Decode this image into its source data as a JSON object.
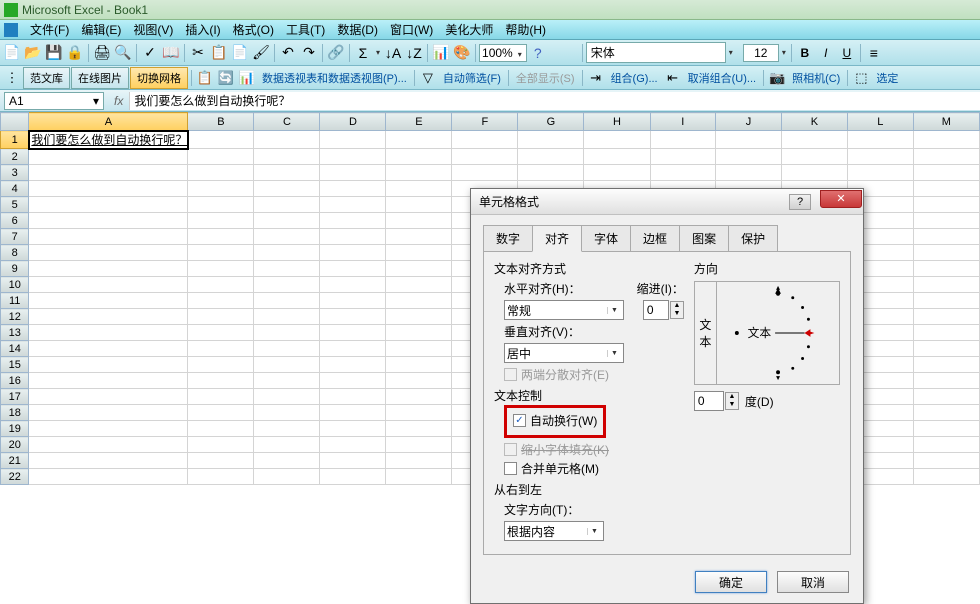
{
  "title": "Microsoft Excel - Book1",
  "menus": [
    "文件(F)",
    "编辑(E)",
    "视图(V)",
    "插入(I)",
    "格式(O)",
    "工具(T)",
    "数据(D)",
    "窗口(W)",
    "美化大师",
    "帮助(H)"
  ],
  "toolbar1": {
    "zoom": "100%",
    "font_name": "宋体",
    "font_size": "12"
  },
  "toolbar2": {
    "tabs": [
      "范文库",
      "在线图片",
      "切换网格"
    ],
    "active_tab_index": 2,
    "pivot_text": "数据透视表和数据透视图(P)...",
    "filter_text": "自动筛选(F)",
    "link_show_all": "全部显示(S)",
    "link_group": "组合(G)...",
    "link_ungroup": "取消组合(U)...",
    "link_camera": "照相机(C)",
    "link_select": "选定"
  },
  "namebox": "A1",
  "fx_label": "fx",
  "formula_value": "我们要怎么做到自动换行呢？",
  "columns": [
    "A",
    "B",
    "C",
    "D",
    "E",
    "F",
    "G",
    "H",
    "I",
    "J",
    "K",
    "L",
    "M"
  ],
  "row_count": 22,
  "cell_a1": "我们要怎么做到自动换行呢？",
  "dialog": {
    "title": "单元格格式",
    "help": "?",
    "close": "✕",
    "tabs": [
      "数字",
      "对齐",
      "字体",
      "边框",
      "图案",
      "保护"
    ],
    "active_tab": 1,
    "section_align": "文本对齐方式",
    "h_align_label": "水平对齐(H)：",
    "h_align_value": "常规",
    "indent_label": "缩进(I)：",
    "indent_value": "0",
    "v_align_label": "垂直对齐(V)：",
    "v_align_value": "居中",
    "justify_label": "两端分散对齐(E)",
    "section_control": "文本控制",
    "wrap_text": "自动换行(W)",
    "shrink_text": "缩小字体填充(K)",
    "merge_text": "合并单元格(M)",
    "section_rtl": "从右到左",
    "direction_label": "文字方向(T)：",
    "direction_value": "根据内容",
    "orientation_label": "方向",
    "orient_vert": "文本",
    "orient_text": "文本",
    "deg_value": "0",
    "deg_label": "度(D)",
    "ok": "确定",
    "cancel": "取消"
  }
}
